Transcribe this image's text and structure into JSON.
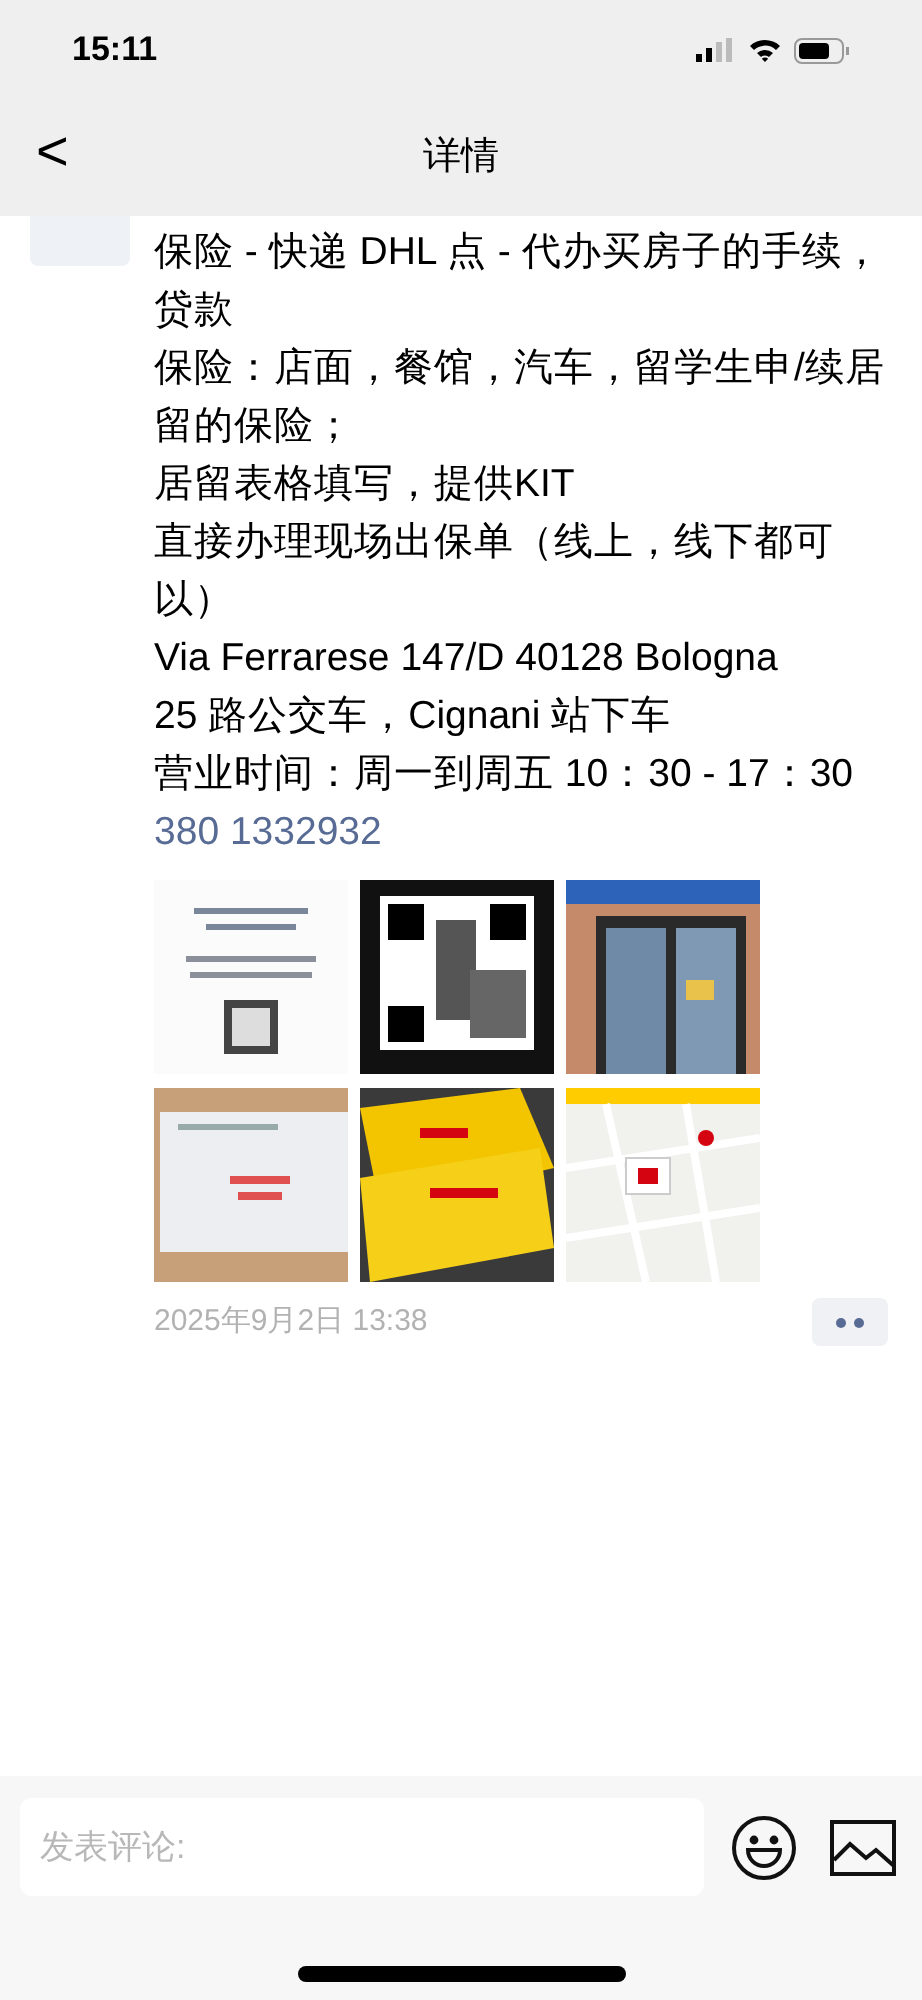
{
  "status_bar": {
    "time": "15:11"
  },
  "nav": {
    "back": "<",
    "title": "详情"
  },
  "post": {
    "lines": [
      {
        "kind": "text",
        "text": "保险 - 快递 DHL 点 - 代办买房子的手续，贷款"
      },
      {
        "kind": "text",
        "text": "保险：店面，餐馆，汽车，留学生申/续居留的保险；"
      },
      {
        "kind": "text",
        "text": "居留表格填写，提供KIT"
      },
      {
        "kind": "text",
        "text": "直接办理现场出保单（线上，线下都可以）"
      },
      {
        "kind": "text",
        "text": "Via Ferrarese 147/D 40128 Bologna"
      },
      {
        "kind": "text",
        "text": "25 路公交车，Cignani 站下车"
      },
      {
        "kind": "text",
        "text": "营业时间：周一到周五  10：30 - 17：30"
      },
      {
        "kind": "phone",
        "text": "380 1332932"
      }
    ],
    "timestamp": "2025年9月2日 13:38"
  },
  "comment_bar": {
    "placeholder": "发表评论:"
  }
}
